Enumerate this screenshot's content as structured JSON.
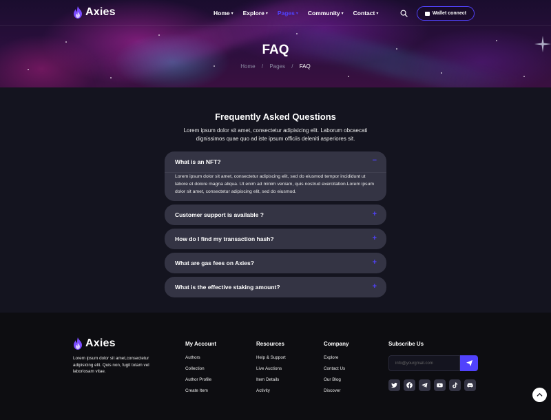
{
  "brand": {
    "name": "Axies",
    "accent": "#5142fc"
  },
  "nav": {
    "items": [
      {
        "label": "Home",
        "active": false
      },
      {
        "label": "Explore",
        "active": false
      },
      {
        "label": "Pages",
        "active": true
      },
      {
        "label": "Community",
        "active": false
      },
      {
        "label": "Contact",
        "active": false
      }
    ],
    "caret": "▾",
    "search_icon": "search-icon",
    "wallet_label": "Wallet connect"
  },
  "hero": {
    "title": "FAQ",
    "breadcrumb": [
      "Home",
      "Pages",
      "FAQ"
    ],
    "separator": "/"
  },
  "faq": {
    "title": "Frequently Asked Questions",
    "description": "Lorem ipsum dolor sit amet, consectetur adipisicing elit. Laborum obcaecati dignissimos quae quo ad iste ipsum officiis deleniti asperiores sit.",
    "items": [
      {
        "question": "What is an NFT?",
        "expanded": true,
        "toggle": "−",
        "answer": "Lorem ipsum dolor sit amet, consectetur adipiscing elit, sed do eiusmod tempor incididunt ut labore et dolore magna aliqua. Ut enim ad minim veniam, quis nostrud exercitation.Lorem ipsum dolor sit amet, consectetur adipiscing elit, sed do eiusmod."
      },
      {
        "question": "Customer support is available ?",
        "expanded": false,
        "toggle": "+"
      },
      {
        "question": "How do I find my transaction hash?",
        "expanded": false,
        "toggle": "+"
      },
      {
        "question": "What are gas fees on Axies?",
        "expanded": false,
        "toggle": "+"
      },
      {
        "question": "What is the effective staking amount?",
        "expanded": false,
        "toggle": "+"
      }
    ]
  },
  "footer": {
    "about": "Lorem ipsum dolor sit amet,consectetur adipisicing elit. Quis non, fugit totam vel laboriosam vitae.",
    "columns": [
      {
        "title": "My Account",
        "links": [
          "Authors",
          "Collection",
          "Author Profile",
          "Create Item"
        ]
      },
      {
        "title": "Resources",
        "links": [
          "Help & Support",
          "Live Auctions",
          "Item Details",
          "Activity"
        ]
      },
      {
        "title": "Company",
        "links": [
          "Explore",
          "Contact Us",
          "Our Blog",
          "Discover"
        ]
      }
    ],
    "subscribe": {
      "title": "Subscribe Us",
      "placeholder": "info@yourgmail.com",
      "button_icon": "send-icon"
    },
    "socials": [
      "twitter-icon",
      "facebook-icon",
      "telegram-icon",
      "youtube-icon",
      "tiktok-icon",
      "discord-icon"
    ]
  }
}
